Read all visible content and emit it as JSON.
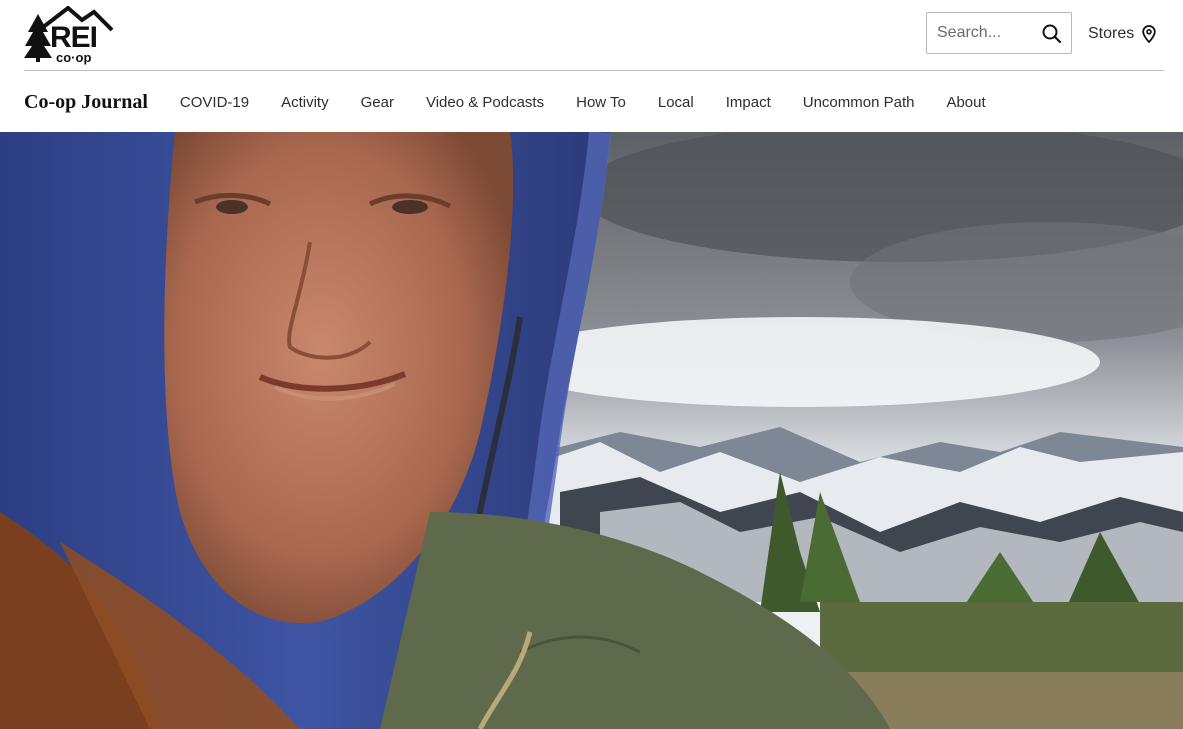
{
  "header": {
    "logo": {
      "text": "REI",
      "subtext": "co·op",
      "icon": "rei-mountain-tree-logo"
    },
    "search": {
      "placeholder": "Search...",
      "icon": "search-icon"
    },
    "stores": {
      "label": "Stores",
      "icon": "location-pin-icon"
    }
  },
  "subnav": {
    "brand": "Co-op Journal",
    "items": [
      {
        "label": "COVID-19"
      },
      {
        "label": "Activity"
      },
      {
        "label": "Gear"
      },
      {
        "label": "Video & Podcasts"
      },
      {
        "label": "How To"
      },
      {
        "label": "Local"
      },
      {
        "label": "Impact"
      },
      {
        "label": "Uncommon Path"
      },
      {
        "label": "About"
      }
    ]
  },
  "hero": {
    "image": "woman-in-blue-hood-mountain-selfie-photo"
  },
  "colors": {
    "text": "#2e2e2b",
    "border": "#bdbdbd",
    "hood": "#3a4f9a",
    "jacket": "#5f6a4c"
  }
}
